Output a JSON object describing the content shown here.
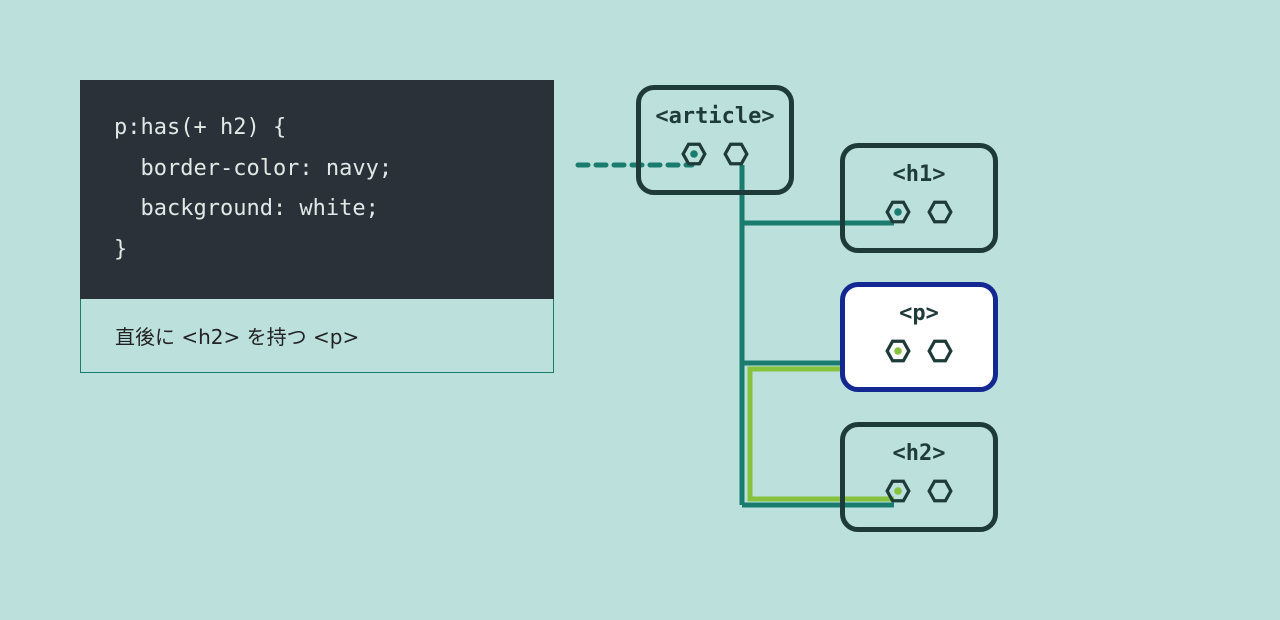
{
  "code": {
    "line1": "p:has(+ h2) {",
    "line2": "  border-color: navy;",
    "line3": "  background: white;",
    "line4": "}"
  },
  "caption": "直後に <h2> を持つ <p>",
  "nodes": {
    "article": "<article>",
    "h1": "<h1>",
    "p": "<p>",
    "h2": "<h2>"
  },
  "colors": {
    "bg": "#bce0dc",
    "codeBg": "#2a3138",
    "nodeBorder": "#1f3b39",
    "selectedBorder": "#142891",
    "wireTeal": "#1a7c6f",
    "wireGreen": "#86c23d"
  }
}
